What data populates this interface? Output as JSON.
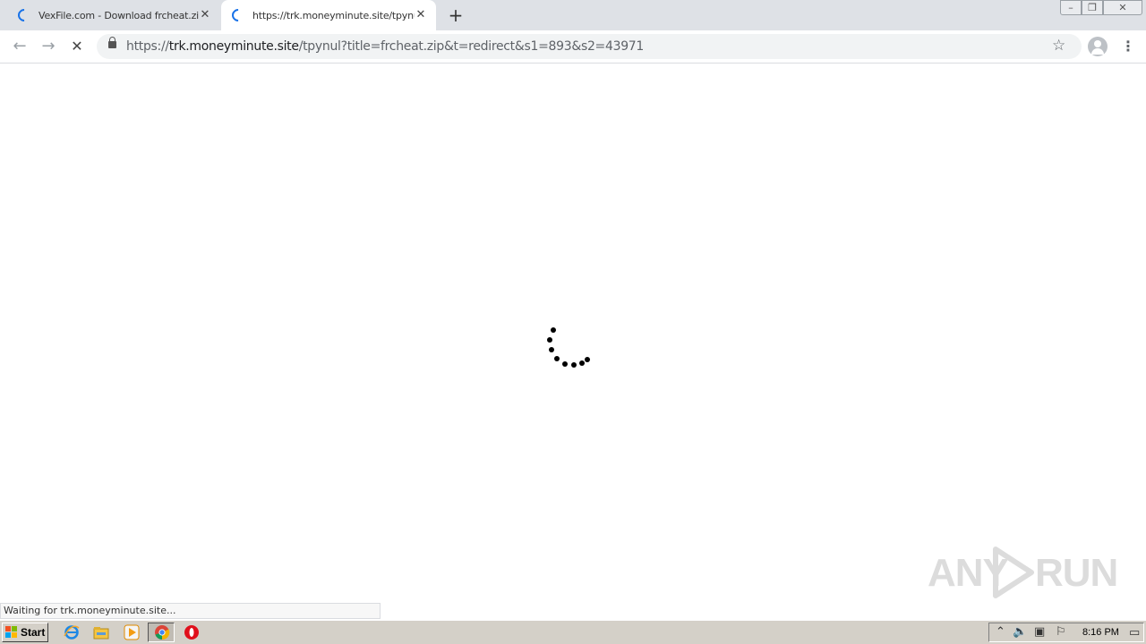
{
  "tabs": [
    {
      "title": "VexFile.com - Download frcheat.zip",
      "state": "loading",
      "active": false
    },
    {
      "title": "https://trk.moneyminute.site/tpynul",
      "state": "loading",
      "active": true
    }
  ],
  "new_tab_label": "+",
  "window_controls": {
    "minimize": "–",
    "maximize": "❐",
    "close": "✕"
  },
  "toolbar": {
    "back_label": "←",
    "forward_label": "→",
    "stop_label": "✕",
    "url_scheme": "https://",
    "url_host": "trk.moneyminute.site",
    "url_path": "/tpynul?title=frcheat.zip&t=redirect&s1=893&s2=43971",
    "bookmark_label": "☆",
    "menu_label": "⋮"
  },
  "status_text": "Waiting for trk.moneyminute.site...",
  "watermark_text": "ANY",
  "watermark_text_2": "RUN",
  "taskbar": {
    "start_label": "Start",
    "clock": "8:16 PM",
    "tray_icons": [
      "chevron-up-icon",
      "speaker-icon",
      "network-icon",
      "flag-icon"
    ],
    "apps": [
      "internet-explorer-icon",
      "file-explorer-icon",
      "media-player-icon",
      "chrome-icon",
      "opera-icon"
    ]
  },
  "colors": {
    "tabstrip": "#dee1e6",
    "accent": "#1a73e8",
    "taskbar": "#d4d0c8"
  }
}
